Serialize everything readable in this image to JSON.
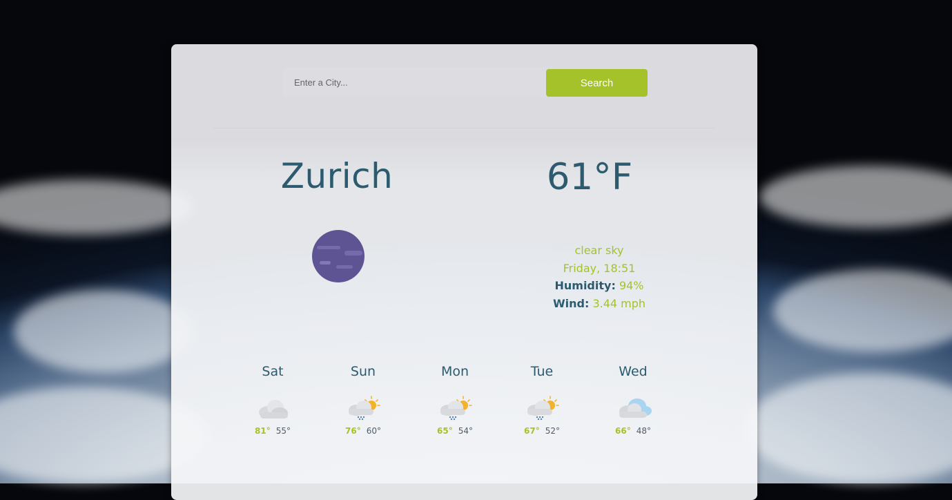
{
  "search": {
    "placeholder": "Enter a City...",
    "button_label": "Search"
  },
  "current": {
    "city": "Zurich",
    "temperature": "61°F",
    "icon": "night-clear-moon-icon",
    "description": "clear sky",
    "datetime": "Friday, 18:51",
    "humidity_label": "Humidity:",
    "humidity_value": "94%",
    "wind_label": "Wind:",
    "wind_value": "3.44 mph"
  },
  "forecast": [
    {
      "day": "Sat",
      "icon": "cloudy-icon",
      "high": "81°",
      "low": "55°"
    },
    {
      "day": "Sun",
      "icon": "sun-rain-cloud-icon",
      "high": "76°",
      "low": "60°"
    },
    {
      "day": "Mon",
      "icon": "sun-rain-cloud-icon",
      "high": "65°",
      "low": "54°"
    },
    {
      "day": "Tue",
      "icon": "sun-rain-cloud-icon",
      "high": "67°",
      "low": "52°"
    },
    {
      "day": "Wed",
      "icon": "blue-cloud-icon",
      "high": "66°",
      "low": "48°"
    }
  ],
  "colors": {
    "accent": "#a5c22a",
    "text": "#2c5a6e",
    "moon": "#5e5494"
  }
}
